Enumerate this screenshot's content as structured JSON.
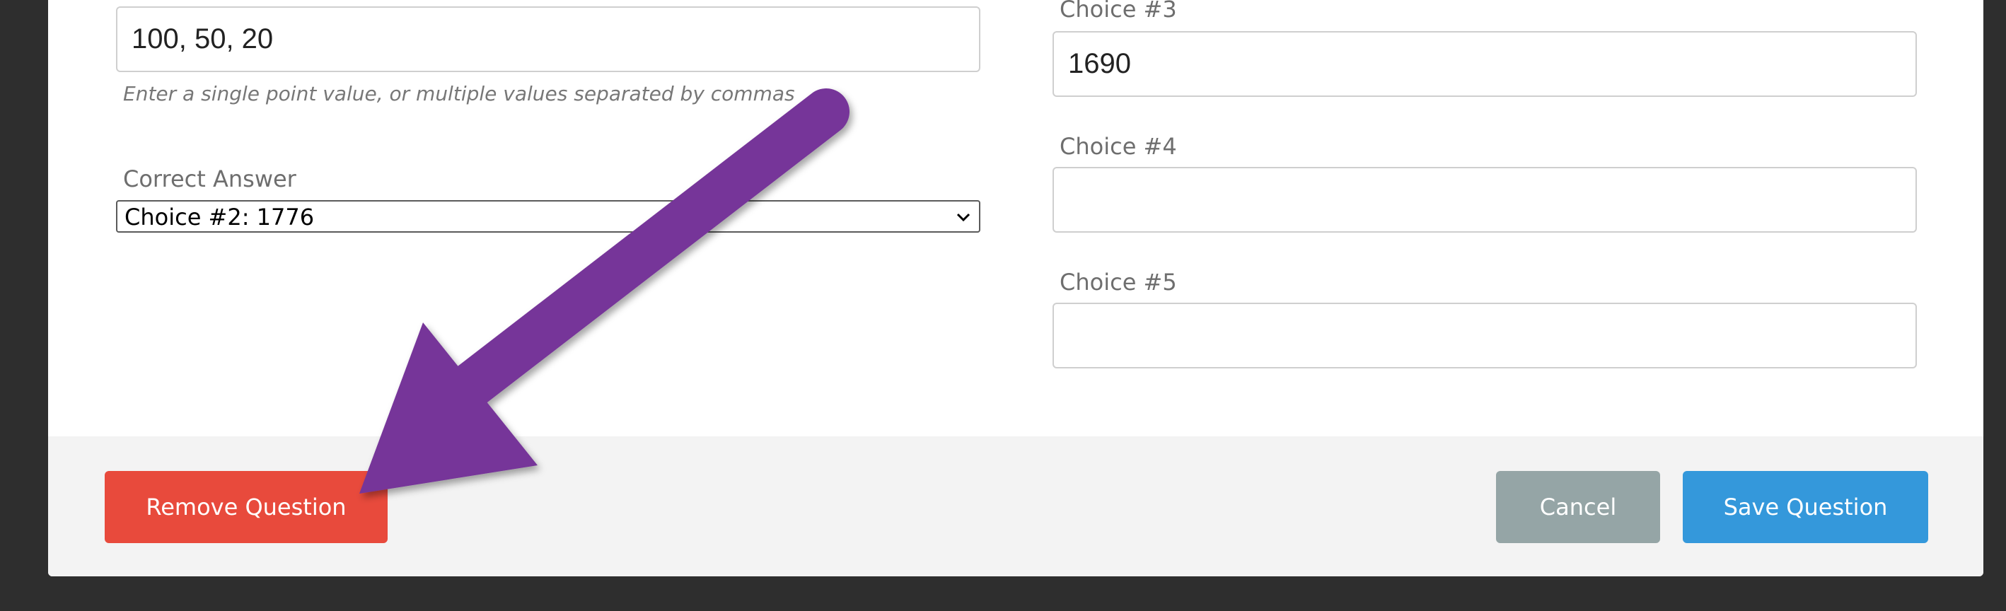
{
  "form": {
    "points": {
      "value": "100, 50, 20",
      "hint": "Enter a single point value, or multiple values separated by commas"
    },
    "correct_answer": {
      "label": "Correct Answer",
      "selected": "Choice #2: 1776"
    },
    "choices": [
      {
        "label": "Choice #3",
        "value": "1690"
      },
      {
        "label": "Choice #4",
        "value": ""
      },
      {
        "label": "Choice #5",
        "value": ""
      }
    ]
  },
  "footer": {
    "remove_label": "Remove Question",
    "cancel_label": "Cancel",
    "save_label": "Save Question"
  },
  "colors": {
    "backdrop": "#2e2e2e",
    "remove": "#e84a3c",
    "cancel": "#95a5a6",
    "save": "#3498db",
    "annotation_arrow": "#763599"
  },
  "icons": {
    "select_caret": "chevron-down-icon",
    "annotation": "arrow-icon"
  }
}
